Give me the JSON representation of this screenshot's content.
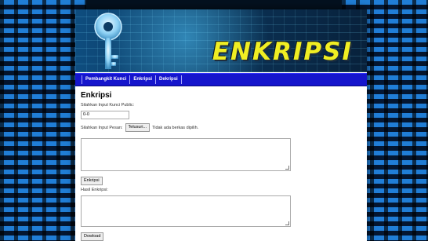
{
  "header": {
    "title": "ENKRIPSI"
  },
  "nav": {
    "items": [
      {
        "label": "Pembangkit Kunci"
      },
      {
        "label": "Enkripsi"
      },
      {
        "label": "Dekripsi"
      }
    ]
  },
  "main": {
    "heading": "Enkripsi",
    "public_key_label": "Silahkan Input Kunci Public:",
    "public_key_value": "0-0",
    "message_label": "Silahkan Input Pesan:",
    "file_button": "Telusuri...",
    "file_status": "Tidak ada berkas dipilih.",
    "encrypt_button": "Enkripsi",
    "result_label": "Hasil Enkripsi:",
    "download_button": "Dowload"
  },
  "colors": {
    "nav_bg": "#1515cc",
    "title_yellow": "#f0ee23",
    "background": "#04111f"
  },
  "icons": {
    "banner": "key-icon"
  }
}
